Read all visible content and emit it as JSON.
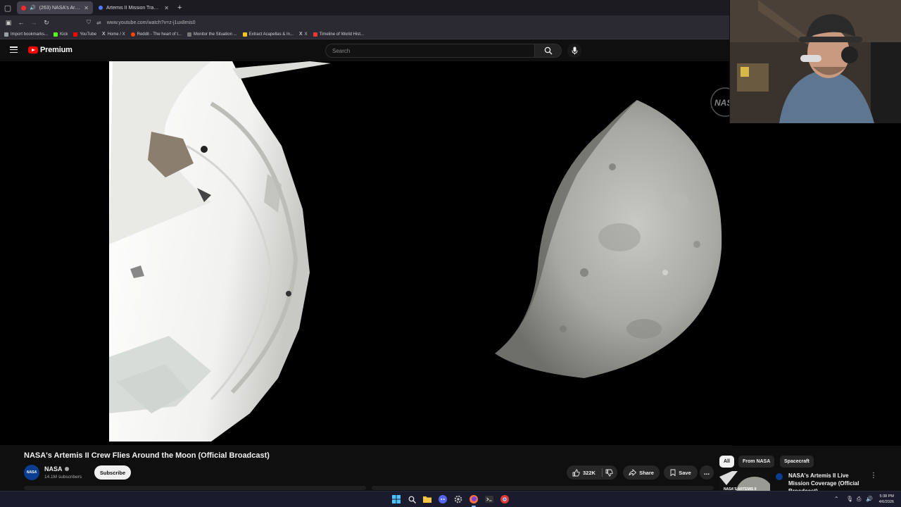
{
  "browser": {
    "tabs": [
      {
        "title": "(263) NASA's Artemis II Cre",
        "active": true
      },
      {
        "title": "Artemis II Mission Tracker | Live",
        "active": false
      }
    ],
    "url": "www.youtube.com/watch?v=z-j1ux8mis0",
    "bookmarks": [
      {
        "label": "Import bookmarks...",
        "color": "#9aa0a6"
      },
      {
        "label": "Kick",
        "color": "#53fc18"
      },
      {
        "label": "YouTube",
        "color": "#ff0000"
      },
      {
        "label": "Home / X",
        "color": "#ffffff"
      },
      {
        "label": "Reddit - The heart of t...",
        "color": "#ff4500"
      },
      {
        "label": "Monitor the Situation ...",
        "color": "#9aa0a6"
      },
      {
        "label": "Extract Acapellas & In...",
        "color": "#f5c518"
      },
      {
        "label": "X",
        "color": "#ffffff"
      },
      {
        "label": "Timeline of World Hist...",
        "color": "#e53935"
      }
    ]
  },
  "youtube": {
    "logo_text": "Premium",
    "search_placeholder": "Search",
    "video": {
      "title": "NASA's Artemis II Crew Flies Around the Moon (Official Broadcast)",
      "channel": "NASA",
      "subscribers": "14.1M subscribers",
      "subscribe_label": "Subscribe",
      "likes": "322K",
      "share_label": "Share",
      "save_label": "Save",
      "more_label": "..."
    },
    "filter_chips": [
      "All",
      "From NASA",
      "Spacecraft"
    ],
    "recommendation": {
      "title": "NASA's Artemis II Live Mission Coverage (Official Broadcast)",
      "thumb_text": "NASA'S ARTEMIS II"
    },
    "watermark": "NASA"
  },
  "taskbar": {
    "time": "5:38 PM",
    "date": "4/6/2026"
  },
  "colors": {
    "youtube_red": "#ff0000",
    "nasa_blue": "#0b3d91"
  }
}
